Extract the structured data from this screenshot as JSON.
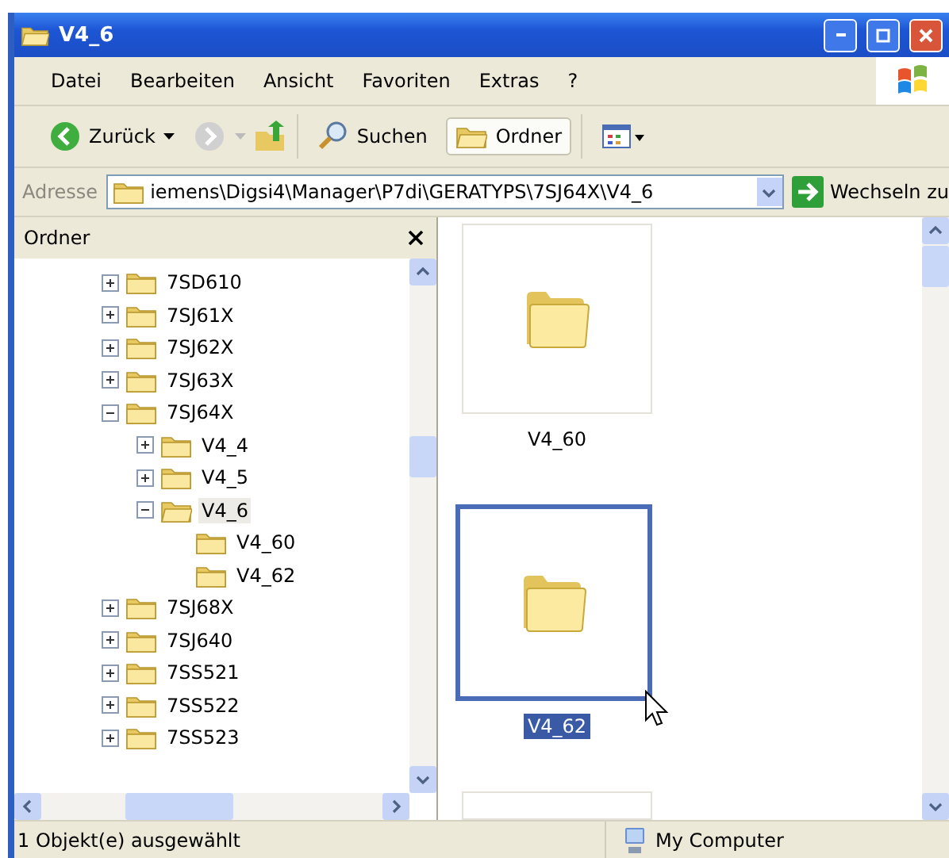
{
  "window": {
    "title": "V4_6"
  },
  "menu": [
    "Datei",
    "Bearbeiten",
    "Ansicht",
    "Favoriten",
    "Extras",
    "?"
  ],
  "toolbar": {
    "back": "Zurück",
    "search": "Suchen",
    "folders": {
      "label": "Ordner",
      "selected": true
    }
  },
  "address": {
    "label": "Adresse",
    "value": "iemens\\Digsi4\\Manager\\P7di\\GERATYPS\\7SJ64X\\V4_6",
    "go": "Wechseln zu"
  },
  "folder_pane": {
    "title": "Ordner",
    "tree": [
      {
        "label": "7SD610",
        "expanded": false,
        "selected": false
      },
      {
        "label": "7SJ61X",
        "expanded": false,
        "selected": false
      },
      {
        "label": "7SJ62X",
        "expanded": false,
        "selected": false
      },
      {
        "label": "7SJ63X",
        "expanded": false,
        "selected": false
      },
      {
        "label": "7SJ64X",
        "expanded": true,
        "selected": false,
        "children": [
          {
            "label": "V4_4",
            "expanded": false,
            "selected": false
          },
          {
            "label": "V4_5",
            "expanded": false,
            "selected": false
          },
          {
            "label": "V4_6",
            "expanded": true,
            "selected": true,
            "children": [
              {
                "label": "V4_60",
                "selected": false
              },
              {
                "label": "V4_62",
                "selected": false
              }
            ]
          }
        ]
      },
      {
        "label": "7SJ68X",
        "expanded": false,
        "selected": false
      },
      {
        "label": "7SJ640",
        "expanded": false,
        "selected": false
      },
      {
        "label": "7SS521",
        "expanded": false,
        "selected": false
      },
      {
        "label": "7SS522",
        "expanded": false,
        "selected": false
      },
      {
        "label": "7SS523",
        "expanded": false,
        "selected": false
      }
    ]
  },
  "files": [
    {
      "kind": "folder",
      "name": "V4_60",
      "selected": false
    },
    {
      "kind": "folder",
      "name": "V4_62",
      "selected": true
    },
    {
      "kind": "cut",
      "selected": false
    }
  ],
  "status_bar": {
    "text": "1 Objekt(e) ausgewählt",
    "location": "My Computer"
  }
}
